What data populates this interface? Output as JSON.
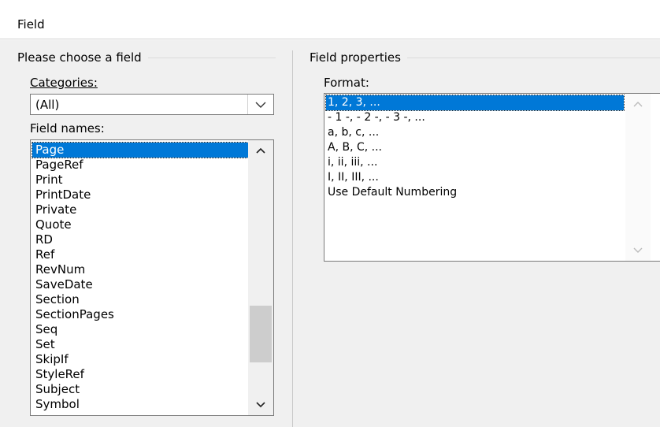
{
  "window": {
    "title": "Field"
  },
  "left_group": {
    "title": "Please choose a field",
    "categories_label": "Categories:",
    "categories_value": "(All)",
    "field_names_label": "Field names:",
    "selected_field": "Page",
    "fields": [
      "Page",
      "PageRef",
      "Print",
      "PrintDate",
      "Private",
      "Quote",
      "RD",
      "Ref",
      "RevNum",
      "SaveDate",
      "Section",
      "SectionPages",
      "Seq",
      "Set",
      "SkipIf",
      "StyleRef",
      "Subject",
      "Symbol"
    ]
  },
  "right_group": {
    "title": "Field properties",
    "format_label": "Format:",
    "selected_format": "1, 2, 3, ...",
    "formats": [
      "1, 2, 3, ...",
      "- 1 -, - 2 -, - 3 -, ...",
      "a, b, c, ...",
      "A, B, C, ...",
      "i, ii, iii, ...",
      "I, II, III, ...",
      "Use Default Numbering"
    ]
  },
  "icons": {
    "combo_arrow": "chevron-down-icon",
    "scroll_up": "chevron-up-icon",
    "scroll_down": "chevron-down-icon"
  },
  "colors": {
    "selection": "#0078d7",
    "window_bg": "#f0f0f0"
  }
}
